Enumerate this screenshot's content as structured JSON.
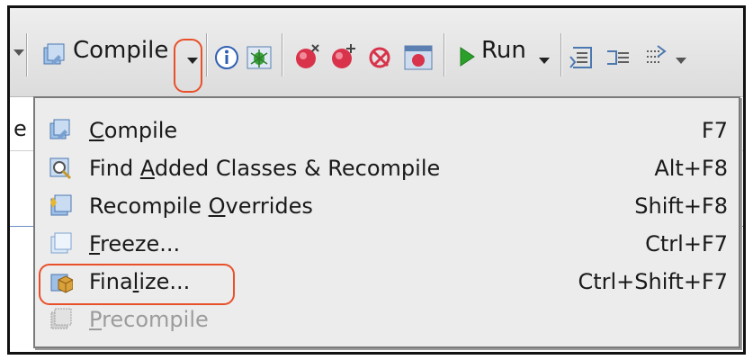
{
  "toolbar": {
    "compile_label": "Compile",
    "run_label": "Run"
  },
  "menu": {
    "compile": {
      "pre": "",
      "ul": "C",
      "post": "ompile",
      "shortcut": "F7"
    },
    "find_added": {
      "pre": "Find ",
      "ul": "A",
      "post": "dded Classes & Recompile",
      "shortcut": "Alt+F8"
    },
    "recompile_overrides": {
      "pre": "Recompile ",
      "ul": "O",
      "post": "verrides",
      "shortcut": "Shift+F8"
    },
    "freeze": {
      "pre": "",
      "ul": "F",
      "post": "reeze...",
      "shortcut": "Ctrl+F7"
    },
    "finalize": {
      "pre": "Fina",
      "ul": "l",
      "post": "ize...",
      "shortcut": "Ctrl+Shift+F7"
    },
    "precompile": {
      "pre": "",
      "ul": "P",
      "post": "recompile",
      "shortcut": ""
    }
  },
  "behind_text": "e",
  "colors": {
    "highlight": "#e8502a",
    "run_green": "#2aa02a"
  }
}
